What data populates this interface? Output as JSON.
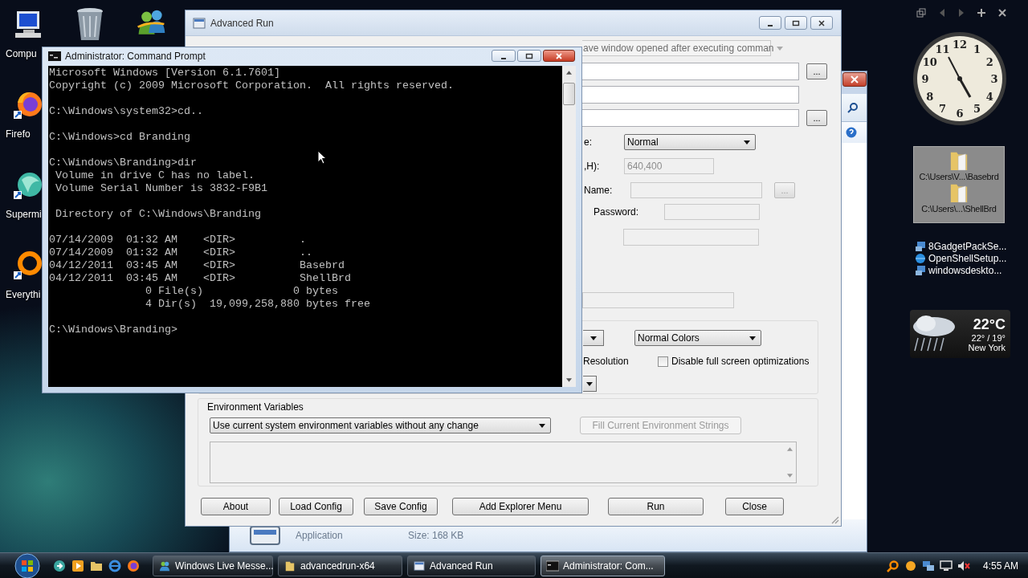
{
  "desktop_icons": [
    {
      "label": "Compu",
      "kind": "computer"
    },
    {
      "label": "Firefo",
      "kind": "firefox"
    },
    {
      "label": "Supermi",
      "kind": "supermium"
    },
    {
      "label": "Everythi",
      "kind": "everything"
    }
  ],
  "desktop_top_icons": [
    {
      "kind": "recycle-bin"
    },
    {
      "kind": "messenger"
    }
  ],
  "explorer_window": {
    "file_type": "Application",
    "file_size": "Size: 168 KB"
  },
  "advanced_run": {
    "title": "Advanced Run",
    "rows": [
      {
        "kind": "combo",
        "value": "ave window opened after executing comman"
      },
      {
        "kind": "input",
        "disabled": false,
        "browse": "..."
      },
      {
        "kind": "input",
        "disabled": false
      },
      {
        "kind": "input",
        "disabled": false,
        "browse": "..."
      },
      {
        "kind": "select",
        "label": "e:",
        "value": "Normal"
      },
      {
        "kind": "input",
        "label": ",H):",
        "value": "640,400",
        "disabled": true
      },
      {
        "kind": "input",
        "label": "Name:",
        "disabled": true,
        "browse": "..."
      },
      {
        "kind": "input",
        "label": "Password:",
        "disabled": true
      },
      {
        "kind": "input",
        "disabled": true
      },
      {
        "kind": "input",
        "disabled": true
      }
    ],
    "color_mode": "Normal Colors",
    "resolution_label": "Resolution",
    "disable_fso": {
      "label": "Disable full screen optimizations",
      "checked": false
    },
    "environment": {
      "label": "Environment Variables",
      "mode": "Use current system environment variables without any change",
      "fill_button": {
        "label": "Fill Current Environment Strings",
        "disabled": true
      }
    },
    "buttons": [
      "About",
      "Load Config",
      "Save Config",
      "Add Explorer Menu",
      "Run",
      "Close"
    ]
  },
  "command_prompt": {
    "title": "Administrator: Command Prompt",
    "blocks": [
      [
        "Microsoft Windows [Version 6.1.7601]",
        "Copyright (c) 2009 Microsoft Corporation.  All rights reserved."
      ],
      [
        "C:\\Windows\\system32>cd.."
      ],
      [
        "C:\\Windows>cd Branding"
      ],
      [
        "C:\\Windows\\Branding>dir",
        " Volume in drive C has no label.",
        " Volume Serial Number is 3832-F9B1"
      ],
      [
        " Directory of C:\\Windows\\Branding"
      ],
      [
        "07/14/2009  01:32 AM    <DIR>          .",
        "07/14/2009  01:32 AM    <DIR>          ..",
        "04/12/2011  03:45 AM    <DIR>          Basebrd",
        "04/12/2011  03:45 AM    <DIR>          ShellBrd",
        "               0 File(s)              0 bytes",
        "               4 Dir(s)  19,099,258,880 bytes free"
      ],
      [
        "C:\\Windows\\Branding>"
      ]
    ]
  },
  "gadgets": {
    "clock_numerals": [
      "12",
      "11",
      "1",
      "10",
      "2",
      "9",
      "3",
      "8",
      "4",
      "7",
      "5",
      "6"
    ],
    "folder_items": [
      "C:\\Users\\V...\\Basebrd",
      "C:\\Users\\...\\ShellBrd"
    ],
    "shortcuts": [
      {
        "label": "8GadgetPackSe...",
        "kind": "installer"
      },
      {
        "label": "OpenShellSetup...",
        "kind": "globe"
      },
      {
        "label": "windowsdeskto...",
        "kind": "installer"
      }
    ],
    "weather": {
      "temperature": "22°C",
      "range": "22° / 19°",
      "city": "New York"
    }
  },
  "taskbar": {
    "tasks": [
      {
        "label": "Windows Live Messe...",
        "kind": "messenger",
        "selected": false
      },
      {
        "label": "advancedrun-x64",
        "kind": "folder",
        "selected": false
      },
      {
        "label": "Advanced Run",
        "kind": "app",
        "selected": false
      },
      {
        "label": "Administrator: Com...",
        "kind": "cmd",
        "selected": true
      }
    ],
    "clock": "4:55 AM"
  }
}
